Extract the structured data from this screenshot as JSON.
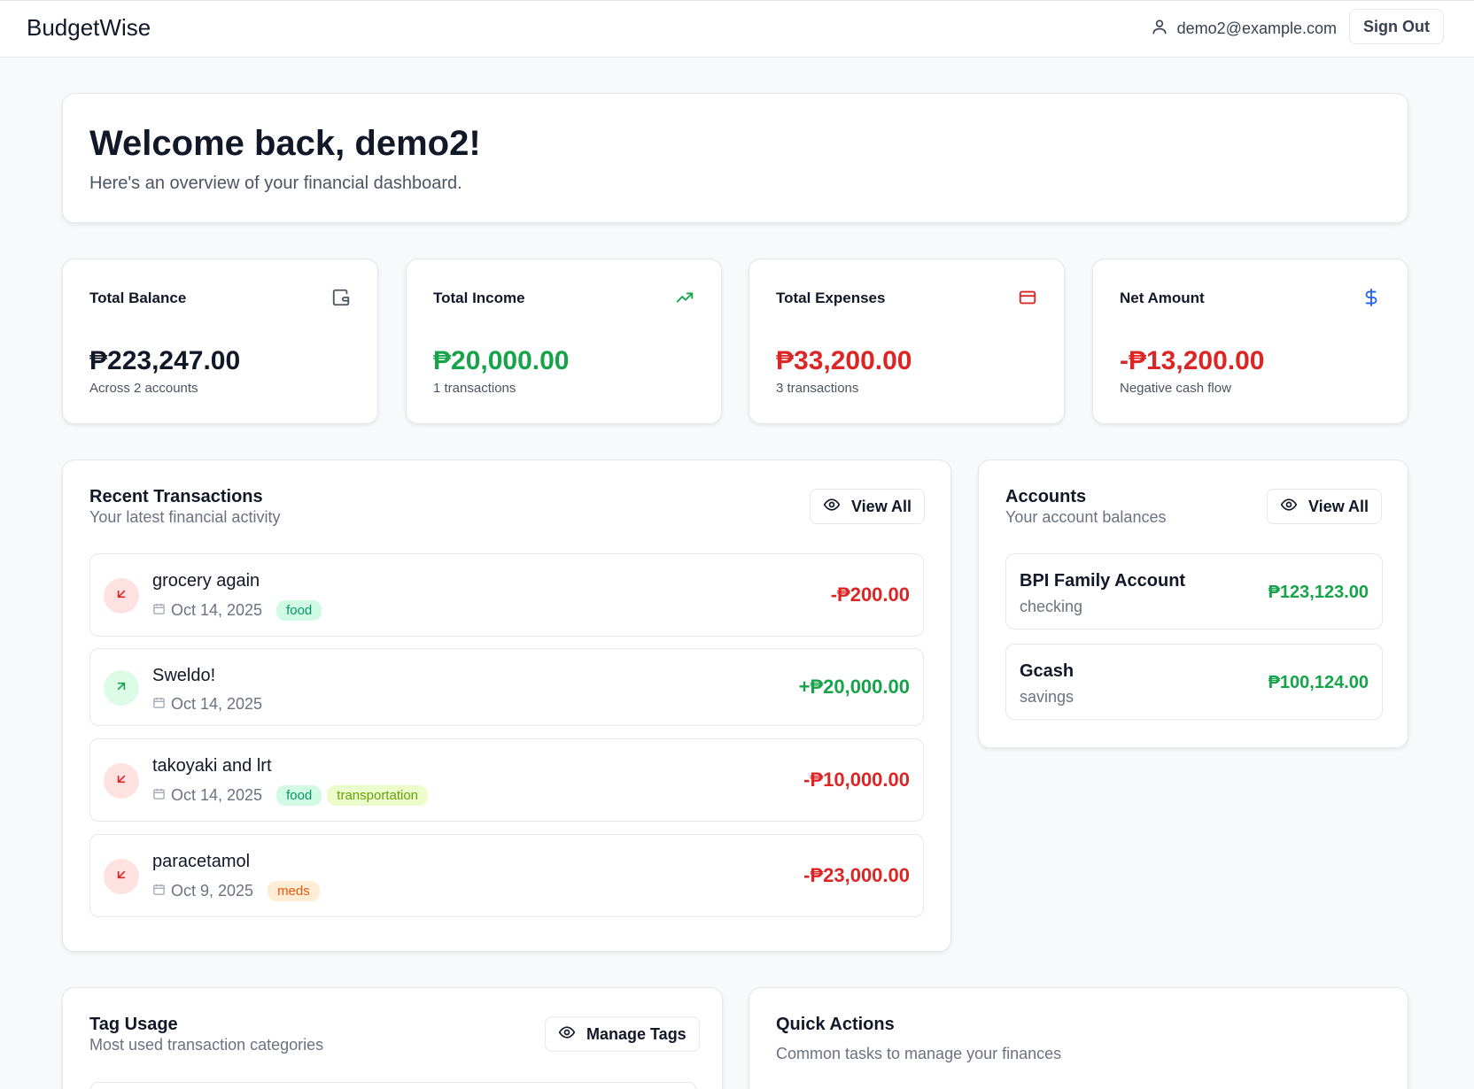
{
  "header": {
    "brand": "BudgetWise",
    "user_email": "demo2@example.com",
    "signout_label": "Sign Out"
  },
  "welcome": {
    "title": "Welcome back, demo2!",
    "subtitle": "Here's an overview of your financial dashboard."
  },
  "stats": [
    {
      "label": "Total Balance",
      "value": "₱223,247.00",
      "sub": "Across 2 accounts",
      "icon": "wallet-icon",
      "color": "#111827"
    },
    {
      "label": "Total Income",
      "value": "₱20,000.00",
      "sub": "1 transactions",
      "icon": "trending-up-icon",
      "color": "#16a34a"
    },
    {
      "label": "Total Expenses",
      "value": "₱33,200.00",
      "sub": "3 transactions",
      "icon": "credit-card-icon",
      "color": "#dc2626"
    },
    {
      "label": "Net Amount",
      "value": "-₱13,200.00",
      "sub": "Negative cash flow",
      "icon": "dollar-icon",
      "color": "#dc2626"
    }
  ],
  "transactions": {
    "title": "Recent Transactions",
    "subtitle": "Your latest financial activity",
    "view_all_label": "View All",
    "items": [
      {
        "name": "grocery again",
        "date": "Oct 14, 2025",
        "tags": [
          "food"
        ],
        "amount": "-₱200.00",
        "type": "expense"
      },
      {
        "name": "Sweldo!",
        "date": "Oct 14, 2025",
        "tags": [],
        "amount": "+₱20,000.00",
        "type": "income"
      },
      {
        "name": "takoyaki and lrt",
        "date": "Oct 14, 2025",
        "tags": [
          "food",
          "transportation"
        ],
        "amount": "-₱10,000.00",
        "type": "expense"
      },
      {
        "name": "paracetamol",
        "date": "Oct 9, 2025",
        "tags": [
          "meds"
        ],
        "amount": "-₱23,000.00",
        "type": "expense"
      }
    ]
  },
  "accounts": {
    "title": "Accounts",
    "subtitle": "Your account balances",
    "view_all_label": "View All",
    "items": [
      {
        "name": "BPI Family Account",
        "type": "checking",
        "balance": "₱123,123.00"
      },
      {
        "name": "Gcash",
        "type": "savings",
        "balance": "₱100,124.00"
      }
    ]
  },
  "tag_usage": {
    "title": "Tag Usage",
    "subtitle": "Most used transaction categories",
    "manage_label": "Manage Tags"
  },
  "quick_actions": {
    "title": "Quick Actions",
    "subtitle": "Common tasks to manage your finances"
  },
  "colors": {
    "income": "#16a34a",
    "expense": "#dc2626",
    "income_bg": "#dcfce7",
    "expense_bg": "#fee2e2",
    "tag_food_bg": "#d1fae5",
    "tag_food_fg": "#059669",
    "tag_transportation_bg": "#ecfccb",
    "tag_transportation_fg": "#65a30d",
    "tag_meds_bg": "#ffedd5",
    "tag_meds_fg": "#ea580c"
  }
}
